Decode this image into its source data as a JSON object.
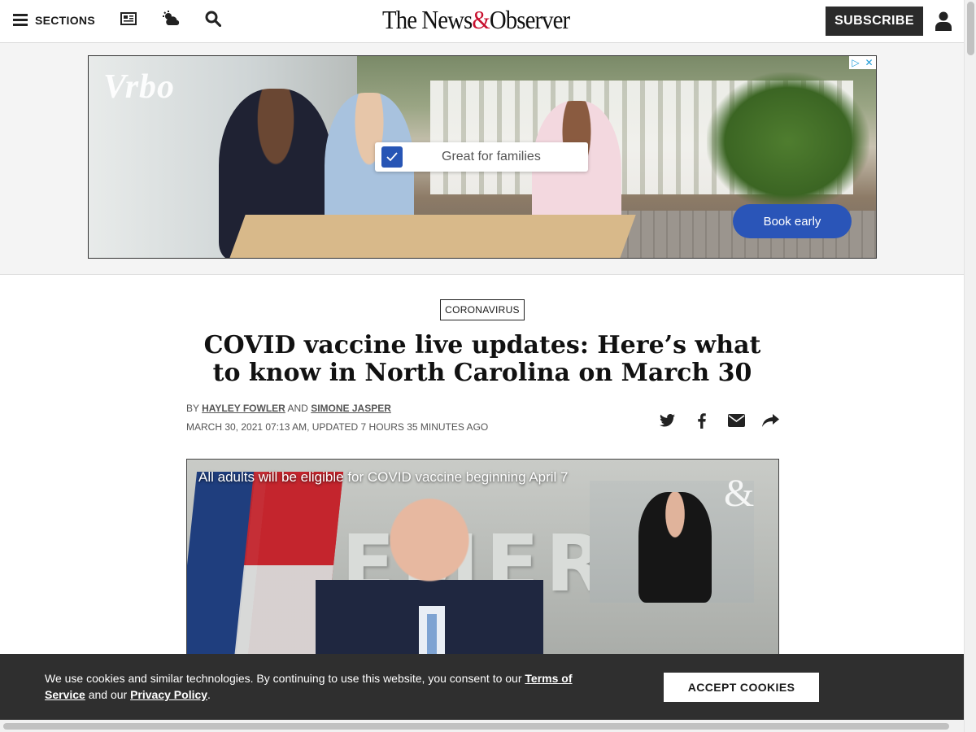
{
  "header": {
    "sections_label": "SECTIONS",
    "masthead_prefix": "The News",
    "masthead_amp": "&",
    "masthead_suffix": "Observer",
    "subscribe_label": "SUBSCRIBE"
  },
  "ad": {
    "brand": "Vrbo",
    "tag_text": "Great for families",
    "cta_label": "Book early",
    "brand_color": "#2a55b8"
  },
  "article": {
    "section_tag": "CORONAVIRUS",
    "headline": "COVID vaccine live updates: Here’s what to know in North Carolina on March 30",
    "byline_prefix": "BY",
    "author1": "HAYLEY FOWLER",
    "byline_and": "AND",
    "author2": "SIMONE JASPER",
    "dateline": "MARCH 30, 2021 07:13 AM, UPDATED 7 HOURS 35 MINUTES AGO",
    "share_icons": [
      "twitter-icon",
      "facebook-icon",
      "email-icon",
      "share-icon"
    ]
  },
  "video": {
    "caption": "All adults will be eligible for COVID vaccine beginning April 7",
    "wall_text": "EMERG",
    "logo": "&"
  },
  "cookie_banner": {
    "text_before": "We use cookies and similar technologies. By continuing to use this website, you consent to our",
    "terms_link": "Terms of Service",
    "text_middle": "and our",
    "privacy_link": "Privacy Policy",
    "text_end": ".",
    "accept_label": "ACCEPT COOKIES"
  }
}
